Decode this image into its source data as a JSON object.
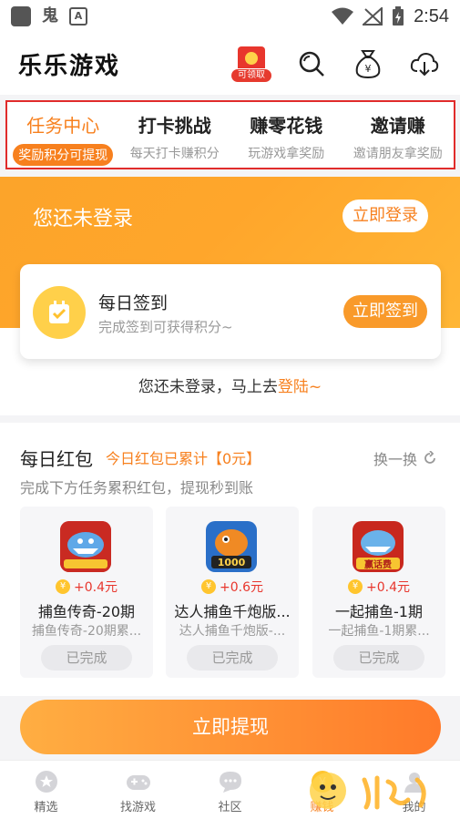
{
  "status_bar": {
    "time": "2:54"
  },
  "header": {
    "app_title": "乐乐游戏",
    "redpack_label": "可领取"
  },
  "tabs": [
    {
      "title": "任务中心",
      "subtitle": "奖励积分可提现",
      "active": true
    },
    {
      "title": "打卡挑战",
      "subtitle": "每天打卡赚积分",
      "active": false
    },
    {
      "title": "赚零花钱",
      "subtitle": "玩游戏拿奖励",
      "active": false
    },
    {
      "title": "邀请赚",
      "subtitle": "邀请朋友拿奖励",
      "active": false
    }
  ],
  "login_banner": {
    "title": "您还未登录",
    "login_button": "立即登录"
  },
  "checkin": {
    "title": "每日签到",
    "subtitle": "完成签到可获得积分~",
    "button": "立即签到"
  },
  "login_prompt": {
    "text": "您还未登录，马上去",
    "link": "登陆~"
  },
  "red_packet": {
    "title": "每日红包",
    "accumulated": "今日红包已累计【0元】",
    "refresh": "换一换",
    "description": "完成下方任务累积红包，提现秒到账",
    "games": [
      {
        "name": "捕鱼传奇-20期",
        "subtitle": "捕鱼传奇-20期累...",
        "reward": "+0.4元",
        "status": "已完成",
        "thumb_color": "#d8352a"
      },
      {
        "name": "达人捕鱼千炮版...",
        "subtitle": "达人捕鱼千炮版-...",
        "reward": "+0.6元",
        "status": "已完成",
        "thumb_color": "#2a6fc8",
        "thumb_text": "1000"
      },
      {
        "name": "一起捕鱼-1期",
        "subtitle": "一起捕鱼-1期累...",
        "reward": "+0.4元",
        "status": "已完成",
        "thumb_color": "#c8281e",
        "thumb_text": "赢话费"
      }
    ],
    "withdraw_button": "立即提现"
  },
  "bottom_nav": [
    {
      "label": "精选",
      "icon": "featured-icon"
    },
    {
      "label": "找游戏",
      "icon": "gamepad-icon"
    },
    {
      "label": "社区",
      "icon": "community-icon"
    },
    {
      "label": "赚钱",
      "icon": "earn-icon",
      "active": true
    },
    {
      "label": "我的",
      "icon": "profile-icon"
    }
  ],
  "colors": {
    "accent": "#f7801e",
    "highlight_border": "#e02b2b",
    "banner": "#ffa62b",
    "reward_red": "#e8362d"
  }
}
